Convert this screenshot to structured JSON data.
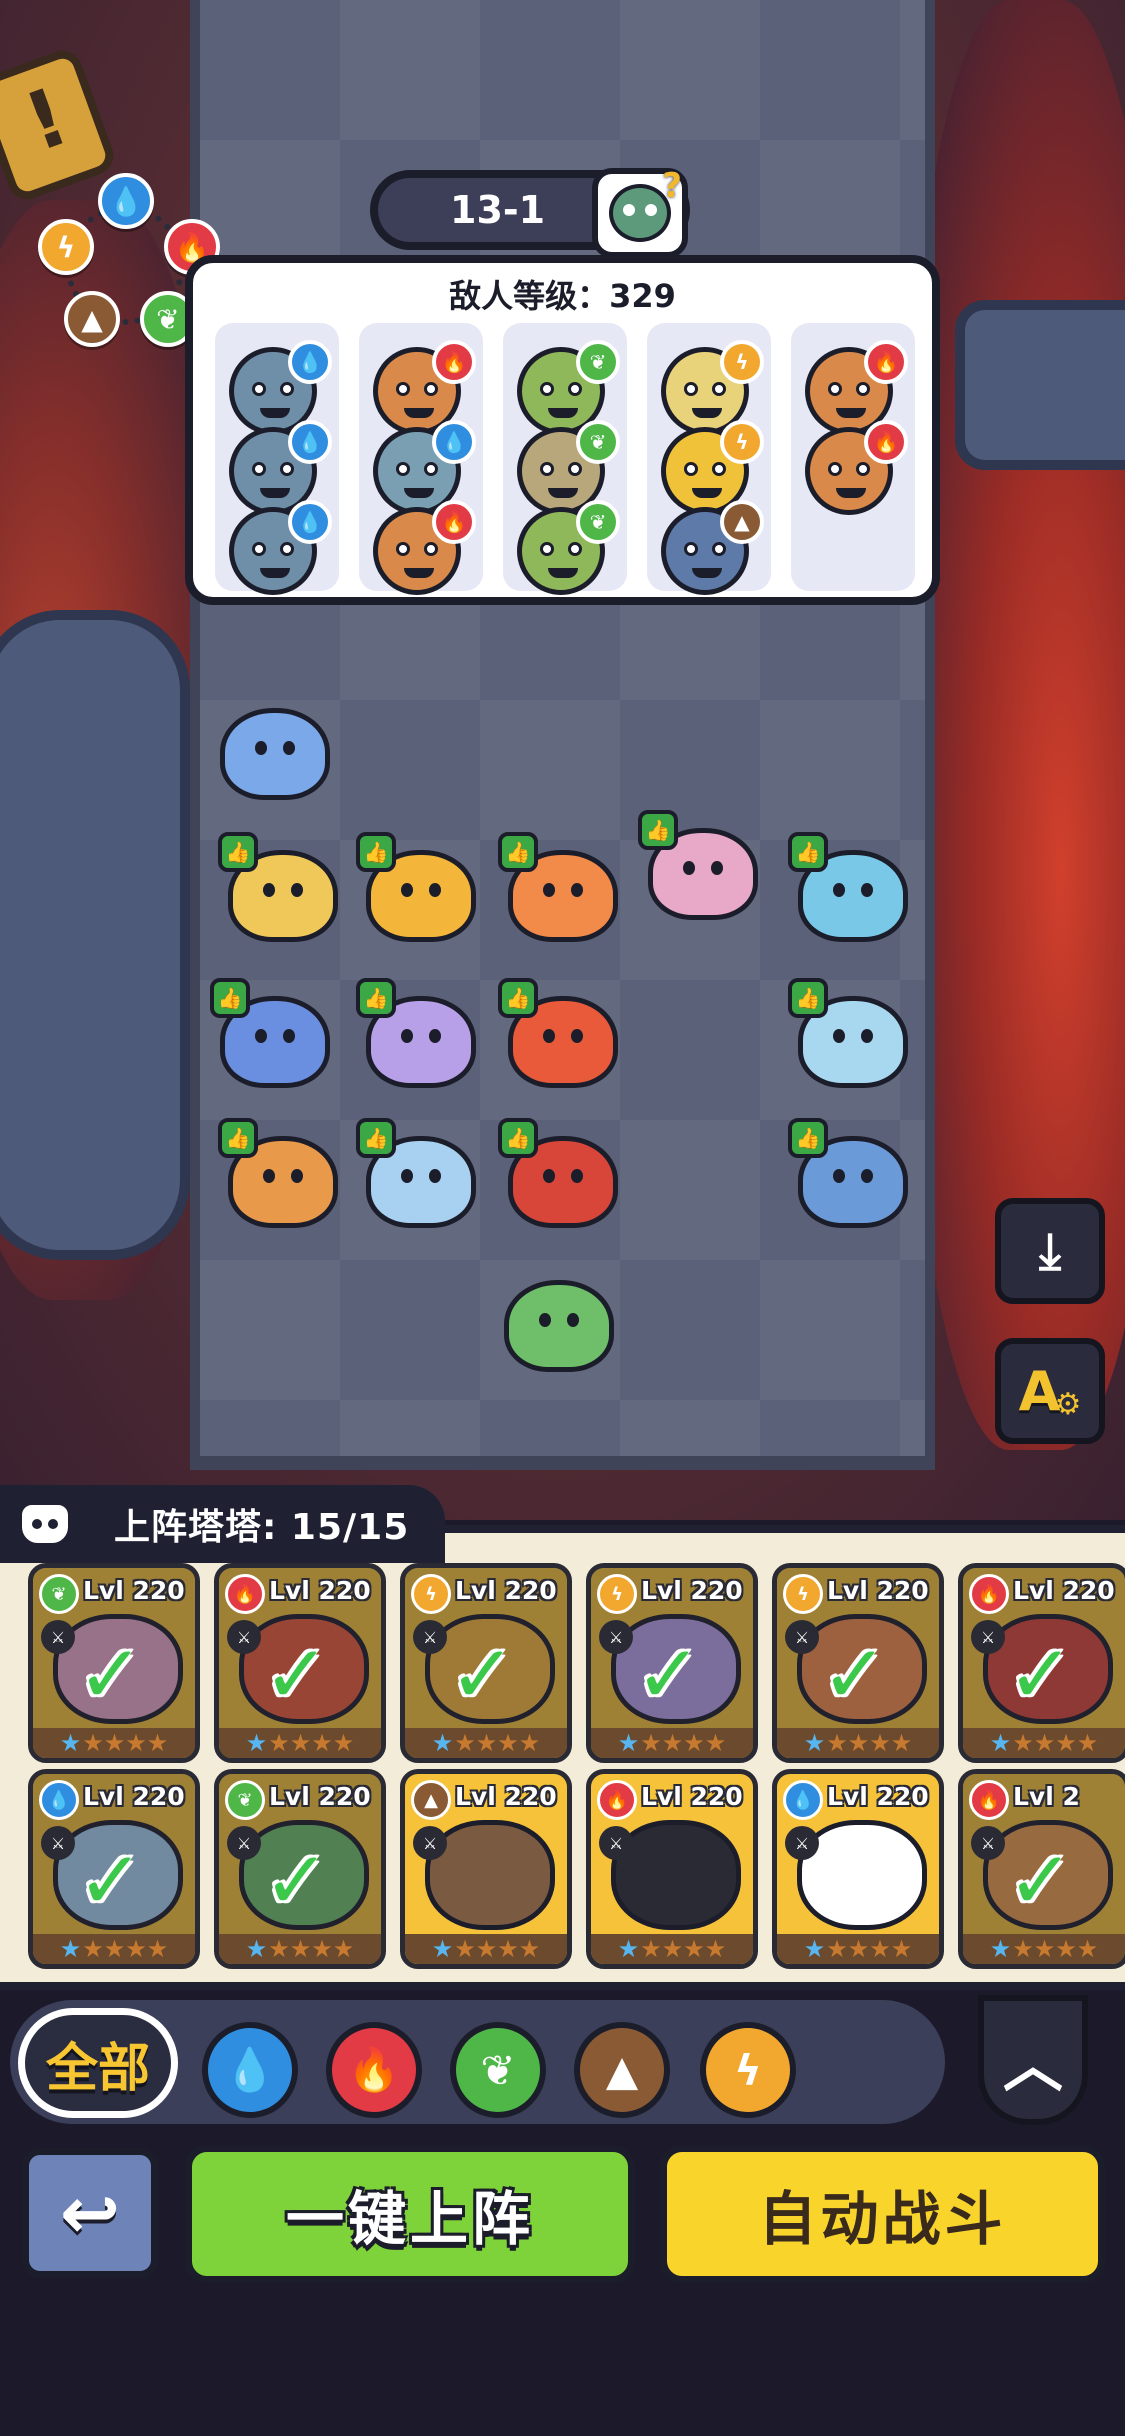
{
  "stage": {
    "label": "13-1"
  },
  "enemy_panel": {
    "level_text": "敌人等级：329",
    "columns": [
      {
        "enemies": [
          {
            "color": "#6f8fa8",
            "element": "water"
          },
          {
            "color": "#6f8fa8",
            "element": "water"
          },
          {
            "color": "#6f8fa8",
            "element": "water"
          }
        ]
      },
      {
        "enemies": [
          {
            "color": "#d98a4a",
            "element": "fire"
          },
          {
            "color": "#7a9fb3",
            "element": "water"
          },
          {
            "color": "#d98a4a",
            "element": "fire"
          }
        ]
      },
      {
        "enemies": [
          {
            "color": "#8fb85a",
            "element": "grass"
          },
          {
            "color": "#b8a77a",
            "element": "grass"
          },
          {
            "color": "#8fb85a",
            "element": "grass"
          }
        ]
      },
      {
        "enemies": [
          {
            "color": "#e8d27a",
            "element": "bolt"
          },
          {
            "color": "#f0c23a",
            "element": "bolt"
          },
          {
            "color": "#5d7aa8",
            "element": "earth"
          }
        ]
      },
      {
        "enemies": [
          {
            "color": "#d98a4a",
            "element": "fire"
          },
          {
            "color": "#d98a4a",
            "element": "fire"
          }
        ]
      }
    ]
  },
  "allies": [
    {
      "color": "#7aa8e8",
      "thumb": false
    },
    {
      "color": "#f0c85a",
      "thumb": true
    },
    {
      "color": "#f3b63a",
      "thumb": true
    },
    {
      "color": "#f28a4a",
      "thumb": true
    },
    {
      "color": "#e8a8c8",
      "thumb": true
    },
    {
      "color": "#7ac8e8",
      "thumb": true
    },
    {
      "color": "#6a8fe0",
      "thumb": true
    },
    {
      "color": "#b8a0e8",
      "thumb": true
    },
    {
      "color": "#e85a3a",
      "thumb": true
    },
    {
      "color": "#a8d8f0",
      "thumb": true
    },
    {
      "color": "#e89a4a",
      "thumb": true
    },
    {
      "color": "#a8d0f0",
      "thumb": true
    },
    {
      "color": "#d8463a",
      "thumb": true
    },
    {
      "color": "#6a9ad8",
      "thumb": true
    },
    {
      "color": "#6fbf6a",
      "thumb": false
    }
  ],
  "roster": {
    "title": "上阵塔塔: 15/15",
    "cards": [
      {
        "level": "Lvl 220",
        "element": "grass",
        "portrait": "#e8a8c8",
        "deployed": true,
        "bg": "#f5c23a"
      },
      {
        "level": "Lvl 220",
        "element": "fire",
        "portrait": "#e85a3a",
        "deployed": true,
        "bg": "#f5c23a"
      },
      {
        "level": "Lvl 220",
        "element": "bolt",
        "portrait": "#f3b63a",
        "deployed": true,
        "bg": "#f5c23a"
      },
      {
        "level": "Lvl 220",
        "element": "bolt",
        "portrait": "#b8a0e8",
        "deployed": true,
        "bg": "#f5c23a"
      },
      {
        "level": "Lvl 220",
        "element": "bolt",
        "portrait": "#f28a4a",
        "deployed": true,
        "bg": "#f5c23a"
      },
      {
        "level": "Lvl 220",
        "element": "fire",
        "portrait": "#d8463a",
        "deployed": true,
        "bg": "#f5c23a"
      },
      {
        "level": "Lvl 220",
        "element": "water",
        "portrait": "#a8d0f0",
        "deployed": true,
        "bg": "#f5c23a"
      },
      {
        "level": "Lvl 220",
        "element": "grass",
        "portrait": "#6fbf6a",
        "deployed": true,
        "bg": "#f5c23a"
      },
      {
        "level": "Lvl 220",
        "element": "earth",
        "portrait": "#7a5a40",
        "deployed": false,
        "bg": "#f5c23a"
      },
      {
        "level": "Lvl 220",
        "element": "fire",
        "portrait": "#2a2a35",
        "deployed": false,
        "bg": "#f5c23a"
      },
      {
        "level": "Lvl 220",
        "element": "water",
        "portrait": "#ffffff",
        "deployed": false,
        "bg": "#f5c23a"
      },
      {
        "level": "Lvl 2",
        "element": "fire",
        "portrait": "#e89a4a",
        "deployed": true,
        "bg": "#f5c23a"
      }
    ]
  },
  "filters": {
    "all_label": "全部",
    "elements": [
      "water",
      "fire",
      "grass",
      "earth",
      "bolt"
    ]
  },
  "buttons": {
    "deploy_label": "一键上阵",
    "auto_battle_label": "自动战斗"
  },
  "colors": {
    "water": "#2f8ee0",
    "fire": "#e23b45",
    "grass": "#4fb748",
    "earth": "#8a5a34",
    "bolt": "#f2a72e"
  },
  "glyphs": {
    "water": "💧",
    "fire": "🔥",
    "grass": "❦",
    "earth": "▲",
    "bolt": "ϟ"
  }
}
